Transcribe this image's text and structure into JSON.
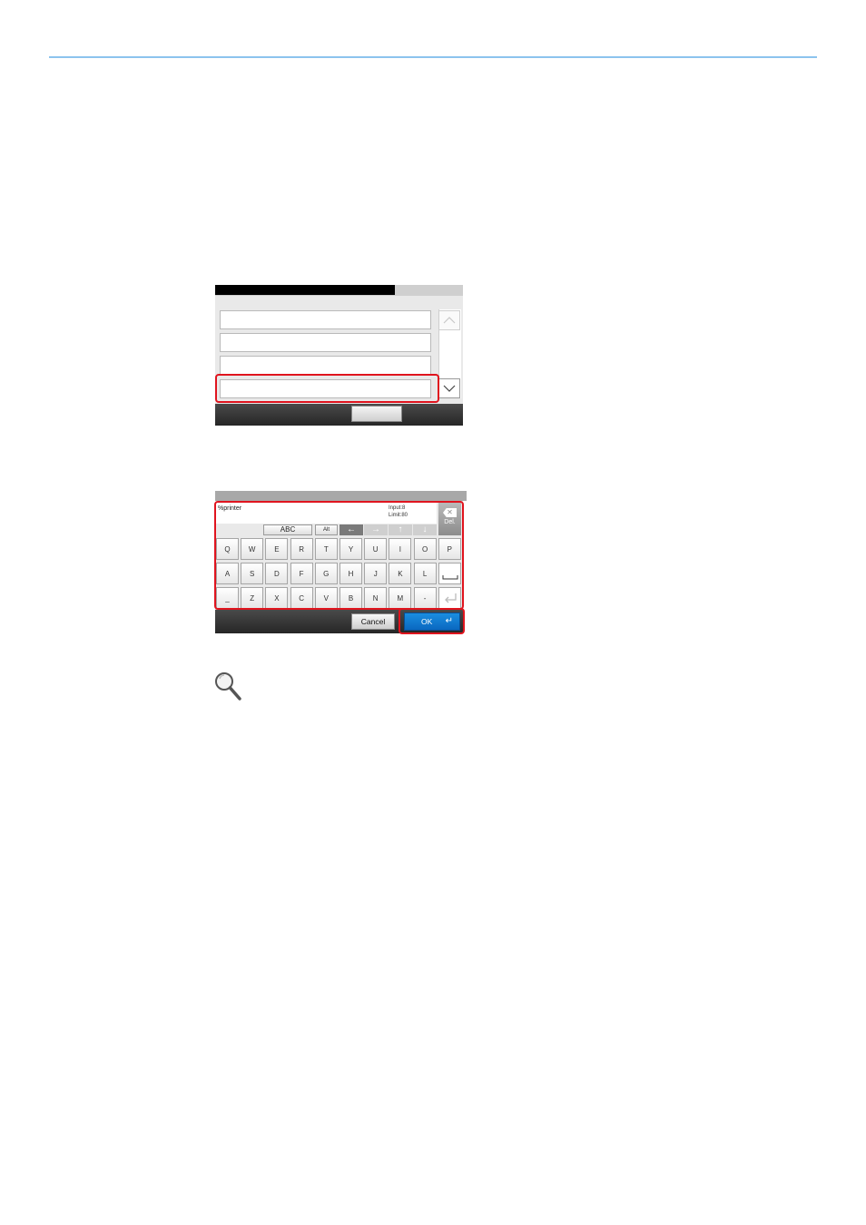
{
  "keyboard": {
    "input_value": "%printer",
    "counter_input": "Input:8",
    "counter_limit": "Limit:80",
    "del_label": "Del.",
    "mode_abc": "ABC",
    "mode_alt": "Alt",
    "row1": [
      "Q",
      "W",
      "E",
      "R",
      "T",
      "Y",
      "U",
      "I",
      "O",
      "P"
    ],
    "row2": [
      "A",
      "S",
      "D",
      "F",
      "G",
      "H",
      "J",
      "K",
      "L"
    ],
    "row3": [
      "_",
      "Z",
      "X",
      "C",
      "V",
      "B",
      "N",
      "M",
      "-"
    ],
    "cancel_label": "Cancel",
    "ok_label": "OK",
    "colors": {
      "highlight": "#e0141e",
      "ok": "#0a78d0"
    }
  },
  "icons": {
    "up": "chevron-up-icon",
    "down": "chevron-down-icon",
    "left": "arrow-left-icon",
    "right": "arrow-right-icon",
    "arrow_up": "arrow-up-icon",
    "arrow_down": "arrow-down-icon",
    "space": "space-icon",
    "enter": "enter-icon",
    "backspace": "backspace-icon",
    "magnifier": "magnifier-icon"
  }
}
